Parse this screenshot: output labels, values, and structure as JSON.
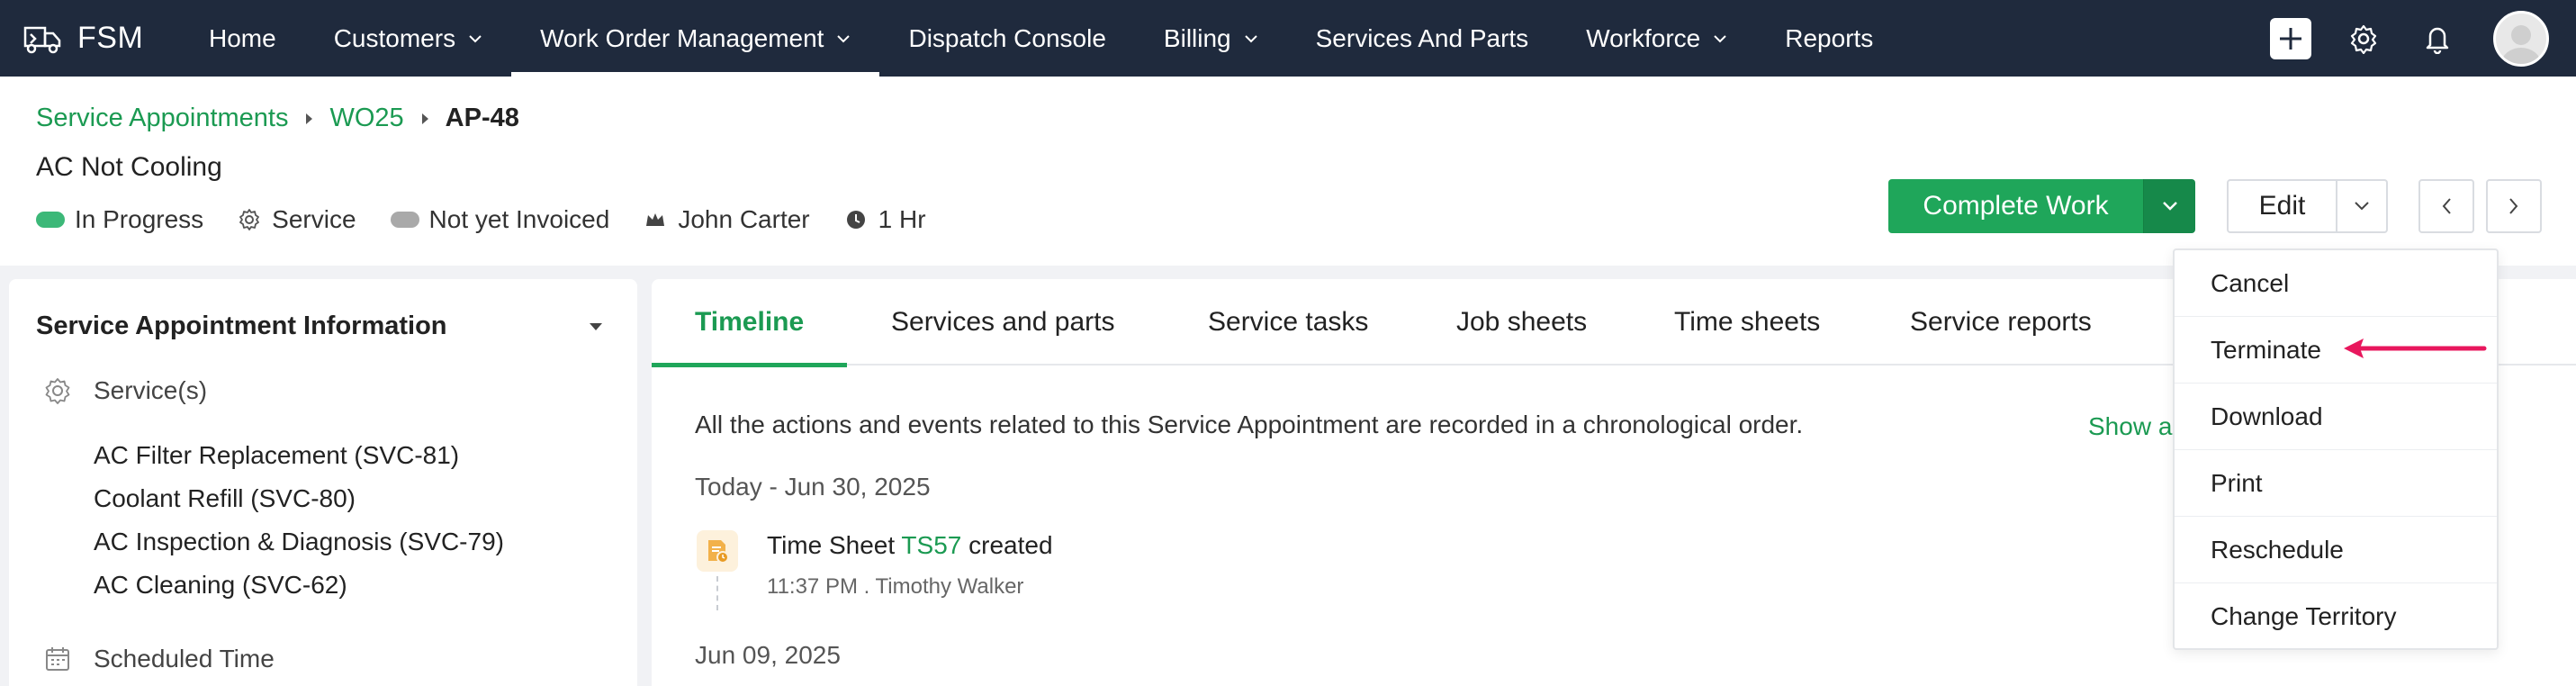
{
  "nav": {
    "brand": "FSM",
    "items": [
      {
        "label": "Home",
        "has_dropdown": false
      },
      {
        "label": "Customers",
        "has_dropdown": true
      },
      {
        "label": "Work Order Management",
        "has_dropdown": true,
        "active": true
      },
      {
        "label": "Dispatch Console",
        "has_dropdown": false
      },
      {
        "label": "Billing",
        "has_dropdown": true
      },
      {
        "label": "Services And Parts",
        "has_dropdown": false
      },
      {
        "label": "Workforce",
        "has_dropdown": true
      },
      {
        "label": "Reports",
        "has_dropdown": false
      }
    ],
    "icons": [
      "plus-icon",
      "gear-icon",
      "bell-icon",
      "avatar"
    ]
  },
  "breadcrumb": {
    "items": [
      "Service Appointments",
      "WO25"
    ],
    "current": "AP-48"
  },
  "record": {
    "subtitle": "AC Not Cooling",
    "status": [
      {
        "label": "In Progress",
        "icon": "pill",
        "color": "#3cb878"
      },
      {
        "label": "Service",
        "icon": "gear-icon"
      },
      {
        "label": "Not yet Invoiced",
        "icon": "pill",
        "color": "#a9a9a9"
      },
      {
        "label": "John Carter",
        "icon": "crown-icon"
      },
      {
        "label": "1 Hr",
        "icon": "clock-icon"
      }
    ]
  },
  "actions": {
    "complete_label": "Complete Work",
    "edit_label": "Edit"
  },
  "left_panel": {
    "title": "Service Appointment Information",
    "services_label": "Service(s)",
    "services": [
      "AC Filter Replacement (SVC-81)",
      "Coolant Refill (SVC-80)",
      "AC Inspection & Diagnosis (SVC-79)",
      "AC Cleaning (SVC-62)"
    ],
    "scheduled_label": "Scheduled Time"
  },
  "tabs": [
    "Timeline",
    "Services and parts",
    "Service tasks",
    "Job sheets",
    "Time sheets",
    "Service reports"
  ],
  "timeline": {
    "description": "All the actions and events related to this Service Appointment are recorded in a chronological order.",
    "show_all": "Show a",
    "groups": [
      {
        "date": "Today - Jun 30, 2025",
        "entry": {
          "prefix": "Time Sheet",
          "link": "TS57",
          "suffix": "created",
          "meta": "11:37 PM . Timothy Walker"
        }
      },
      {
        "date": "Jun 09, 2025"
      }
    ]
  },
  "dropdown_menu": {
    "items": [
      "Cancel",
      "Terminate",
      "Download",
      "Print",
      "Reschedule",
      "Change Territory"
    ],
    "highlighted": "Terminate",
    "annotation_color": "#e8175d"
  },
  "colors": {
    "nav_bg": "#1f2a3d",
    "accent_green": "#1fa65a",
    "link_green": "#1b9a52",
    "page_bg": "#f1f2f5"
  }
}
